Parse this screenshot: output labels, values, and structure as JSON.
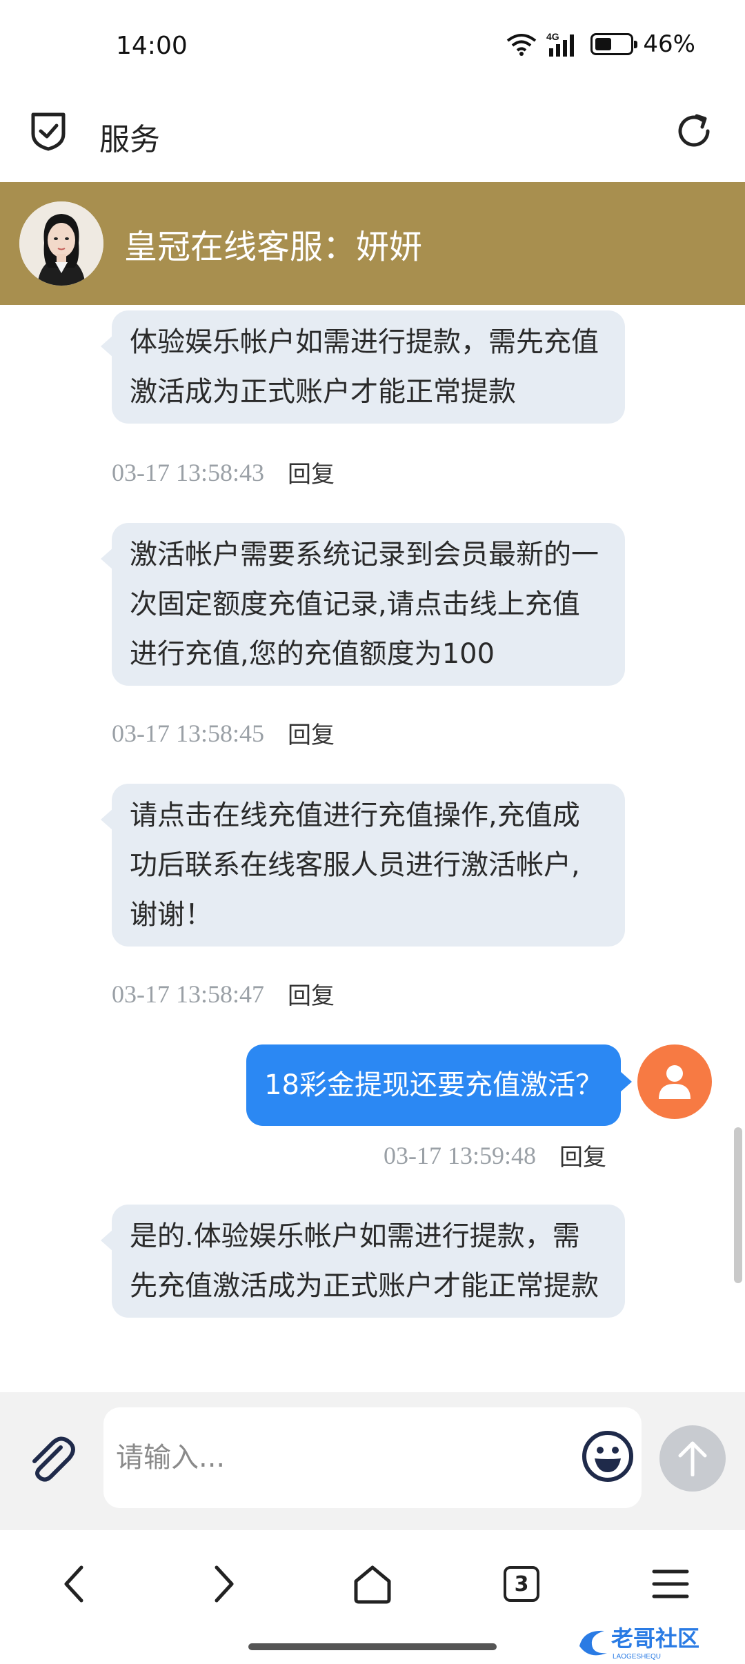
{
  "status_bar": {
    "time": "14:00",
    "network": "4G",
    "battery_percent": "46%",
    "battery_level": 0.46
  },
  "header": {
    "title": "服务"
  },
  "chat_header": {
    "title": "皇冠在线客服：妍妍"
  },
  "messages": [
    {
      "direction": "in",
      "text": "体验娱乐帐户如需进行提款，需先充值激活成为正式账户才能正常提款",
      "timestamp": "03-17 13:58:43",
      "reply": "回复"
    },
    {
      "direction": "in",
      "text": "激活帐户需要系统记录到会员最新的一次固定额度充值记录,请点击线上充值进行充值,您的充值额度为100",
      "timestamp": "03-17 13:58:45",
      "reply": "回复"
    },
    {
      "direction": "in",
      "text": "请点击在线充值进行充值操作,充值成功后联系在线客服人员进行激活帐户,谢谢！",
      "timestamp": "03-17 13:58:47",
      "reply": "回复"
    },
    {
      "direction": "out",
      "text": "18彩金提现还要充值激活？",
      "timestamp": "03-17 13:59:48",
      "reply": "回复"
    },
    {
      "direction": "in",
      "text": "是的.体验娱乐帐户如需进行提款，需先充值激活成为正式账户才能正常提款",
      "timestamp": "",
      "reply": ""
    }
  ],
  "input": {
    "placeholder": "请输入..."
  },
  "browser_nav": {
    "tabs_count": "3"
  },
  "watermark": {
    "text": "老哥社区",
    "subtext": "LAOGESHEQU"
  },
  "colors": {
    "chat_header_bg": "#a88f4f",
    "incoming_bubble": "#e6ecf3",
    "outgoing_bubble": "#2b88f3",
    "user_avatar": "#f77a43"
  }
}
